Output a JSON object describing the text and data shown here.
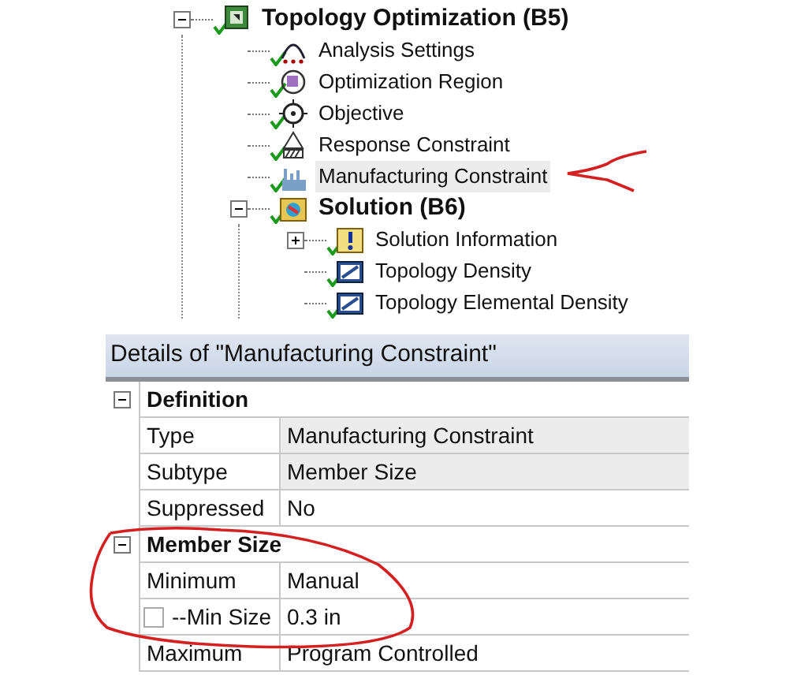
{
  "tree": [
    {
      "label": "Topology Optimization (B5)",
      "kind": "study",
      "bold": true,
      "expanded": true,
      "children": [
        {
          "label": "Analysis Settings",
          "kind": "settings"
        },
        {
          "label": "Optimization Region",
          "kind": "region"
        },
        {
          "label": "Objective",
          "kind": "objective"
        },
        {
          "label": "Response Constraint",
          "kind": "response"
        },
        {
          "label": "Manufacturing Constraint",
          "kind": "manufacturing",
          "selected": true
        },
        {
          "label": "Solution (B6)",
          "kind": "solution",
          "bold": true,
          "expanded": true,
          "children": [
            {
              "label": "Solution Information",
              "kind": "info",
              "expanded": false
            },
            {
              "label": "Topology Density",
              "kind": "density"
            },
            {
              "label": "Topology Elemental Density",
              "kind": "density"
            }
          ]
        }
      ]
    }
  ],
  "details": {
    "title": "Details of \"Manufacturing Constraint\"",
    "rows": [
      {
        "kind": "section",
        "label": "Definition",
        "expanded": true
      },
      {
        "kind": "property",
        "label": "Type",
        "value": "Manufacturing Constraint",
        "readonly": true
      },
      {
        "kind": "property",
        "label": "Subtype",
        "value": "Member Size",
        "readonly": true
      },
      {
        "kind": "property",
        "label": "Suppressed",
        "value": "No",
        "readonly": false
      },
      {
        "kind": "section",
        "label": "Member Size",
        "expanded": true
      },
      {
        "kind": "property",
        "label": "Minimum",
        "value": "Manual",
        "readonly": false
      },
      {
        "kind": "parameter",
        "label": "--Min Size",
        "value": "0.3 in",
        "checked": false,
        "readonly": false
      },
      {
        "kind": "property",
        "label": "Maximum",
        "value": "Program Controlled",
        "readonly": false
      }
    ]
  }
}
